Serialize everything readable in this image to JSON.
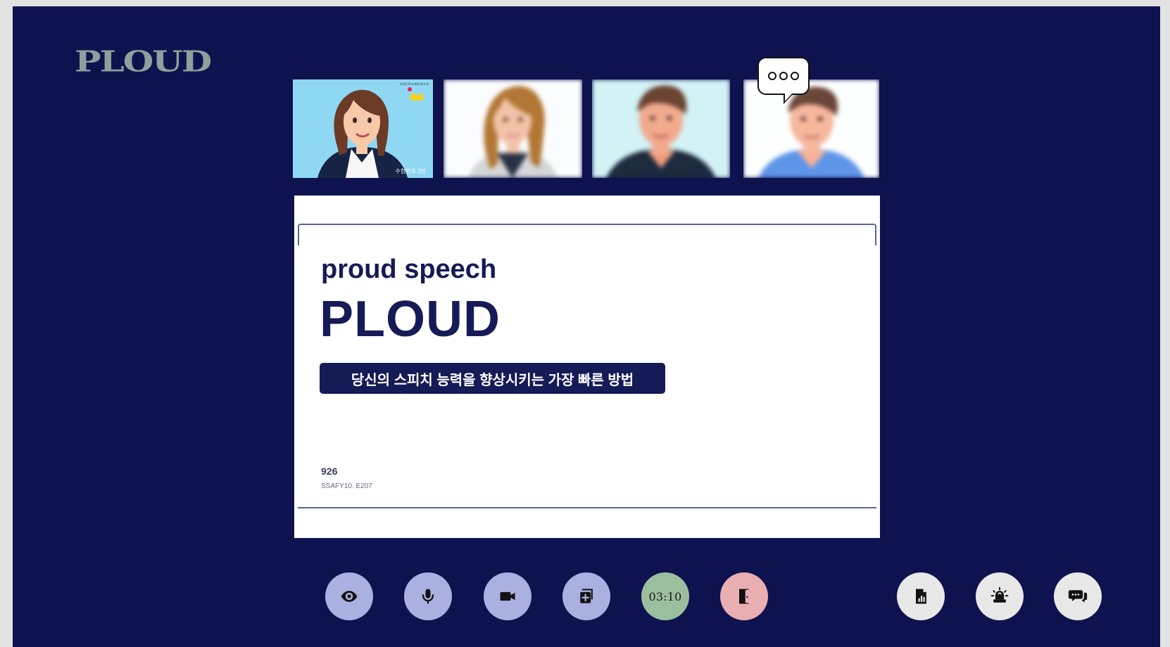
{
  "app": {
    "logo": "PLOUD"
  },
  "participants": {
    "tile_1": {
      "label": "수험번호 2번",
      "small_text": "이곳은 로고 위치 로고 우"
    },
    "speaking_indicator": "speech-bubble-icon"
  },
  "slide": {
    "subtitle": "proud speech",
    "title": "PLOUD",
    "tagline": "당신의 스피치 능력을 향상시키는 가장 빠른 방법",
    "team": "926",
    "code": "SSAFY10. E207"
  },
  "controls": {
    "timer": "03:10",
    "icons": {
      "view": "eye-icon",
      "microphone": "microphone-icon",
      "camera": "video-camera-icon",
      "add": "add-document-icon",
      "exit": "door-exit-icon",
      "report": "report-chart-icon",
      "alarm": "alarm-siren-icon",
      "chat": "chat-icon"
    }
  },
  "colors": {
    "background": "#0e134f",
    "slide_text": "#151b56",
    "control_blue": "#aab1e1",
    "control_green": "#9bbf9e",
    "control_pink": "#e8aeb1",
    "control_gray": "#e8e8e8"
  }
}
